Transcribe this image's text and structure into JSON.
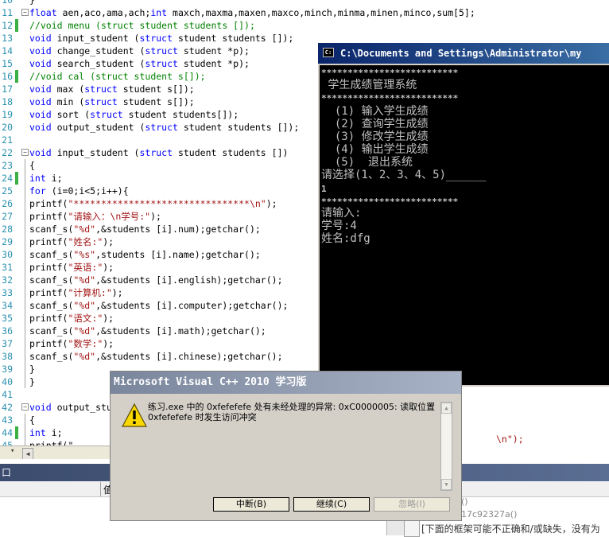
{
  "editor": {
    "lines": [
      {
        "num": "10",
        "fold": "",
        "changed": false,
        "tokens": [
          {
            "t": "}",
            "c": ""
          }
        ]
      },
      {
        "num": "11",
        "fold": "minus",
        "changed": false,
        "tokens": [
          {
            "t": "float",
            "c": "kw"
          },
          {
            "t": " aen,aco,ama,ach;",
            "c": ""
          },
          {
            "t": "int",
            "c": "kw"
          },
          {
            "t": " maxch,maxma,maxen,maxco,minch,minma,minen,minco,sum[5];",
            "c": ""
          }
        ]
      },
      {
        "num": "12",
        "fold": "",
        "changed": true,
        "tokens": [
          {
            "t": "//void menu (struct student students []);",
            "c": "cm"
          }
        ]
      },
      {
        "num": "13",
        "fold": "",
        "changed": false,
        "tokens": [
          {
            "t": "void",
            "c": "kw"
          },
          {
            "t": " input_student (",
            "c": ""
          },
          {
            "t": "struct",
            "c": "kw"
          },
          {
            "t": " student students []);",
            "c": ""
          }
        ]
      },
      {
        "num": "14",
        "fold": "",
        "changed": false,
        "tokens": [
          {
            "t": "void",
            "c": "kw"
          },
          {
            "t": " change_student (",
            "c": ""
          },
          {
            "t": "struct",
            "c": "kw"
          },
          {
            "t": " student *p);",
            "c": ""
          }
        ]
      },
      {
        "num": "15",
        "fold": "",
        "changed": false,
        "tokens": [
          {
            "t": "void",
            "c": "kw"
          },
          {
            "t": " search_student (",
            "c": ""
          },
          {
            "t": "struct",
            "c": "kw"
          },
          {
            "t": " student *p);",
            "c": ""
          }
        ]
      },
      {
        "num": "16",
        "fold": "",
        "changed": true,
        "tokens": [
          {
            "t": "//void cal (struct student s[]);",
            "c": "cm"
          }
        ]
      },
      {
        "num": "17",
        "fold": "",
        "changed": false,
        "tokens": [
          {
            "t": "void",
            "c": "kw"
          },
          {
            "t": " max (",
            "c": ""
          },
          {
            "t": "struct",
            "c": "kw"
          },
          {
            "t": " student s[]);",
            "c": ""
          }
        ]
      },
      {
        "num": "18",
        "fold": "",
        "changed": false,
        "tokens": [
          {
            "t": "void",
            "c": "kw"
          },
          {
            "t": " min (",
            "c": ""
          },
          {
            "t": "struct",
            "c": "kw"
          },
          {
            "t": " student s[]);",
            "c": ""
          }
        ]
      },
      {
        "num": "19",
        "fold": "",
        "changed": false,
        "tokens": [
          {
            "t": "void",
            "c": "kw"
          },
          {
            "t": " sort (",
            "c": ""
          },
          {
            "t": "struct",
            "c": "kw"
          },
          {
            "t": " student students[]);",
            "c": ""
          }
        ]
      },
      {
        "num": "20",
        "fold": "",
        "changed": false,
        "tokens": [
          {
            "t": "void",
            "c": "kw"
          },
          {
            "t": " output_student (",
            "c": ""
          },
          {
            "t": "struct",
            "c": "kw"
          },
          {
            "t": " student students []);",
            "c": ""
          }
        ]
      },
      {
        "num": "21",
        "fold": "",
        "changed": false,
        "tokens": []
      },
      {
        "num": "22",
        "fold": "minus",
        "changed": false,
        "tokens": [
          {
            "t": "void",
            "c": "kw"
          },
          {
            "t": " input_student (",
            "c": ""
          },
          {
            "t": "struct",
            "c": "kw"
          },
          {
            "t": " student students [])",
            "c": ""
          }
        ]
      },
      {
        "num": "23",
        "fold": "line",
        "changed": false,
        "tokens": [
          {
            "t": "{",
            "c": ""
          }
        ]
      },
      {
        "num": "24",
        "fold": "line",
        "changed": true,
        "tokens": [
          {
            "t": "int",
            "c": "kw"
          },
          {
            "t": " i;",
            "c": ""
          }
        ]
      },
      {
        "num": "25",
        "fold": "line",
        "changed": false,
        "tokens": [
          {
            "t": "for",
            "c": "kw"
          },
          {
            "t": " (i=0;i<5;i++){",
            "c": ""
          }
        ]
      },
      {
        "num": "26",
        "fold": "line",
        "changed": false,
        "tokens": [
          {
            "t": "printf(",
            "c": ""
          },
          {
            "t": "\"********************************\\n\"",
            "c": "st"
          },
          {
            "t": ");",
            "c": ""
          }
        ]
      },
      {
        "num": "27",
        "fold": "line",
        "changed": false,
        "tokens": [
          {
            "t": "printf(",
            "c": ""
          },
          {
            "t": "\"请输入：\\n学号:\"",
            "c": "st"
          },
          {
            "t": ");",
            "c": ""
          }
        ]
      },
      {
        "num": "28",
        "fold": "line",
        "changed": false,
        "tokens": [
          {
            "t": "scanf_s(",
            "c": ""
          },
          {
            "t": "\"%d\"",
            "c": "st"
          },
          {
            "t": ",&students [i].num);getchar();",
            "c": ""
          }
        ]
      },
      {
        "num": "29",
        "fold": "line",
        "changed": false,
        "tokens": [
          {
            "t": "printf(",
            "c": ""
          },
          {
            "t": "\"姓名:\"",
            "c": "st"
          },
          {
            "t": ");",
            "c": ""
          }
        ]
      },
      {
        "num": "30",
        "fold": "line",
        "changed": false,
        "tokens": [
          {
            "t": "scanf_s(",
            "c": ""
          },
          {
            "t": "\"%s\"",
            "c": "st"
          },
          {
            "t": ",students [i].name);getchar();",
            "c": ""
          }
        ]
      },
      {
        "num": "31",
        "fold": "line",
        "changed": false,
        "tokens": [
          {
            "t": "printf(",
            "c": ""
          },
          {
            "t": "\"英语:\"",
            "c": "st"
          },
          {
            "t": ");",
            "c": ""
          }
        ]
      },
      {
        "num": "32",
        "fold": "line",
        "changed": false,
        "tokens": [
          {
            "t": "scanf_s(",
            "c": ""
          },
          {
            "t": "\"%d\"",
            "c": "st"
          },
          {
            "t": ",&students [i].english);getchar();",
            "c": ""
          }
        ]
      },
      {
        "num": "33",
        "fold": "line",
        "changed": false,
        "tokens": [
          {
            "t": "printf(",
            "c": ""
          },
          {
            "t": "\"计算机:\"",
            "c": "st"
          },
          {
            "t": ");",
            "c": ""
          }
        ]
      },
      {
        "num": "34",
        "fold": "line",
        "changed": false,
        "tokens": [
          {
            "t": "scanf_s(",
            "c": ""
          },
          {
            "t": "\"%d\"",
            "c": "st"
          },
          {
            "t": ",&students [i].computer);getchar();",
            "c": ""
          }
        ]
      },
      {
        "num": "35",
        "fold": "line",
        "changed": false,
        "tokens": [
          {
            "t": "printf(",
            "c": ""
          },
          {
            "t": "\"语文:\"",
            "c": "st"
          },
          {
            "t": ");",
            "c": ""
          }
        ]
      },
      {
        "num": "36",
        "fold": "line",
        "changed": false,
        "tokens": [
          {
            "t": "scanf_s(",
            "c": ""
          },
          {
            "t": "\"%d\"",
            "c": "st"
          },
          {
            "t": ",&students [i].math);getchar();",
            "c": ""
          }
        ]
      },
      {
        "num": "37",
        "fold": "line",
        "changed": false,
        "tokens": [
          {
            "t": "printf(",
            "c": ""
          },
          {
            "t": "\"数学:\"",
            "c": "st"
          },
          {
            "t": ");",
            "c": ""
          }
        ]
      },
      {
        "num": "38",
        "fold": "line",
        "changed": false,
        "tokens": [
          {
            "t": "scanf_s(",
            "c": ""
          },
          {
            "t": "\"%d\"",
            "c": "st"
          },
          {
            "t": ",&students [i].chinese);getchar();",
            "c": ""
          }
        ]
      },
      {
        "num": "39",
        "fold": "line",
        "changed": false,
        "tokens": [
          {
            "t": "}",
            "c": ""
          }
        ]
      },
      {
        "num": "40",
        "fold": "line",
        "changed": false,
        "tokens": [
          {
            "t": "}",
            "c": ""
          }
        ]
      },
      {
        "num": "41",
        "fold": "",
        "changed": false,
        "tokens": []
      },
      {
        "num": "42",
        "fold": "minus",
        "changed": false,
        "tokens": [
          {
            "t": "void",
            "c": "kw"
          },
          {
            "t": " output_stu",
            "c": ""
          }
        ]
      },
      {
        "num": "43",
        "fold": "line",
        "changed": false,
        "tokens": [
          {
            "t": "{",
            "c": ""
          }
        ]
      },
      {
        "num": "44",
        "fold": "line",
        "changed": true,
        "tokens": [
          {
            "t": "int",
            "c": "kw"
          },
          {
            "t": " i;",
            "c": ""
          }
        ]
      },
      {
        "num": "45",
        "fold": "line",
        "changed": false,
        "tokens": [
          {
            "t": "printf(\"",
            "c": ""
          }
        ]
      }
    ],
    "hidden_fragment": "\\n\");"
  },
  "console": {
    "title": "C:\\Documents and Settings\\Administrator\\my",
    "lines": [
      {
        "text": "**************************",
        "small": true
      },
      {
        "text": " 学生成绩管理系统",
        "small": false
      },
      {
        "text": "**************************",
        "small": true
      },
      {
        "text": "  (1) 输入学生成绩",
        "small": false
      },
      {
        "text": "  (2) 查询学生成绩",
        "small": false
      },
      {
        "text": "  (3) 修改学生成绩",
        "small": false
      },
      {
        "text": "  (4) 输出学生成绩",
        "small": false
      },
      {
        "text": "  (5)  退出系统",
        "small": false
      },
      {
        "text": "请选择(1、2、3、4、5)______",
        "small": false
      },
      {
        "text": "1",
        "small": true
      },
      {
        "text": "**************************",
        "small": true
      },
      {
        "text": "请输入:",
        "small": false
      },
      {
        "text": "学号:4",
        "small": false
      },
      {
        "text": "姓名:dfg",
        "small": false
      }
    ]
  },
  "dialog": {
    "title": "Microsoft Visual C++ 2010 学习版",
    "message": "练习.exe 中的 0xfefefefe 处有未经处理的异常: 0xC0000005: 读取位置 0xfefefefe 时发生访问冲突",
    "buttons": {
      "break": "中断(B)",
      "continue": "继续(C)",
      "ignore": "忽略(I)"
    }
  },
  "output": {
    "title": "口",
    "column2": "值",
    "right_line1": "()",
    "right_line2": "17c92327a()",
    "right_line3": "[下面的框架可能不正确和/或缺失，没有为"
  },
  "colors": {
    "keyword": "#0000ff",
    "comment": "#008000",
    "string": "#a31515",
    "linenum": "#2b91af",
    "change_bar": "#3cb043"
  }
}
